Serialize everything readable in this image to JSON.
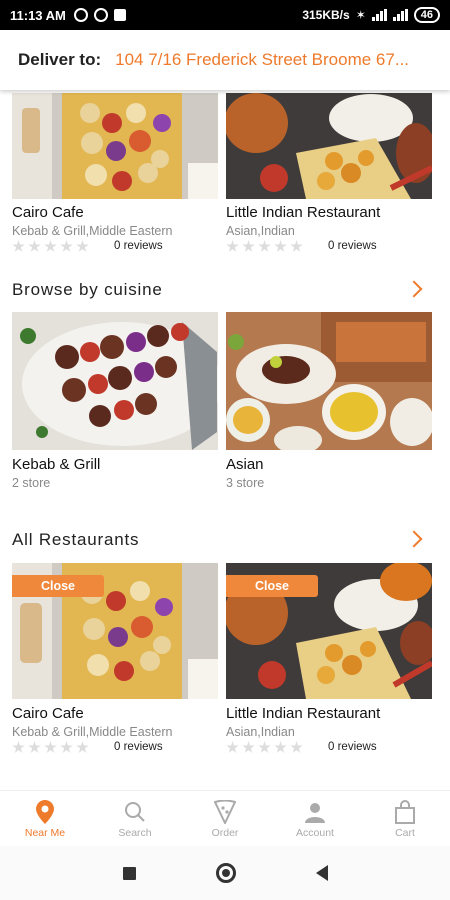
{
  "status_bar": {
    "time": "11:13 AM",
    "speed": "315KB/s",
    "battery": "46"
  },
  "header": {
    "deliver_label": "Deliver to:",
    "address": "104 7/16 Frederick Street Broome 67..."
  },
  "top_restaurants": [
    {
      "name": "Cairo Cafe",
      "cuisine": "Kebab & Grill,Middle Eastern",
      "reviews": "0 reviews",
      "rating": 0
    },
    {
      "name": "Little Indian Restaurant",
      "cuisine": "Asian,Indian",
      "reviews": "0 reviews",
      "rating": 0
    }
  ],
  "browse": {
    "title": "Browse by cuisine",
    "items": [
      {
        "name": "Kebab & Grill",
        "count": "2 store"
      },
      {
        "name": "Asian",
        "count": "3 store"
      }
    ]
  },
  "all_restaurants": {
    "title": "All Restaurants",
    "items": [
      {
        "name": "Cairo Cafe",
        "cuisine": "Kebab & Grill,Middle Eastern",
        "reviews": "0 reviews",
        "badge": "Close",
        "rating": 0
      },
      {
        "name": "Little Indian Restaurant",
        "cuisine": "Asian,Indian",
        "reviews": "0 reviews",
        "badge": "Close",
        "rating": 0
      }
    ]
  },
  "bottom_nav": [
    {
      "label": "Near Me",
      "icon": "location-pin-icon",
      "active": true
    },
    {
      "label": "Search",
      "icon": "search-icon",
      "active": false
    },
    {
      "label": "Order",
      "icon": "pizza-slice-icon",
      "active": false
    },
    {
      "label": "Account",
      "icon": "account-icon",
      "active": false
    },
    {
      "label": "Cart",
      "icon": "shopping-bag-icon",
      "active": false
    }
  ],
  "colors": {
    "accent": "#ee7a2c",
    "badge": "#f0883c"
  }
}
